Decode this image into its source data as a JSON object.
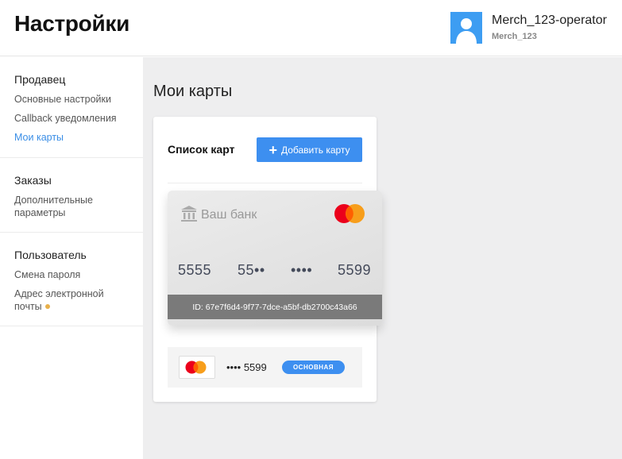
{
  "header": {
    "title": "Настройки",
    "user_name": "Merch_123-operator",
    "user_login": "Merch_123"
  },
  "sidebar": {
    "sections": [
      {
        "title": "Продавец",
        "items": [
          "Основные настройки",
          "Callback уведомления",
          "Мои карты"
        ]
      },
      {
        "title": "Заказы",
        "items": [
          "Дополнительные параметры"
        ]
      },
      {
        "title": "Пользователь",
        "items": [
          "Смена пароля",
          "Адрес электронной почты"
        ]
      }
    ],
    "active_item": "Мои карты"
  },
  "main": {
    "section_title": "Мои карты",
    "list_title": "Список карт",
    "add_button": "Добавить карту",
    "card": {
      "bank_name": "Ваш банк",
      "number_groups": [
        "5555",
        "55••",
        "••••",
        "5599"
      ],
      "id_text": "ID: 67e7f6d4-9f77-7dce-a5bf-db2700c43a66",
      "brand_icon": "mastercard-icon"
    },
    "card_row": {
      "masked_number": "•••• 5599",
      "badge": "ОСНОВНАЯ"
    }
  },
  "colors": {
    "accent": "#3d8ff0",
    "link": "#3a8ee6",
    "mc_red": "#eb001b",
    "mc_orange": "#f79e1b",
    "warning_dot": "#e8b04a"
  }
}
